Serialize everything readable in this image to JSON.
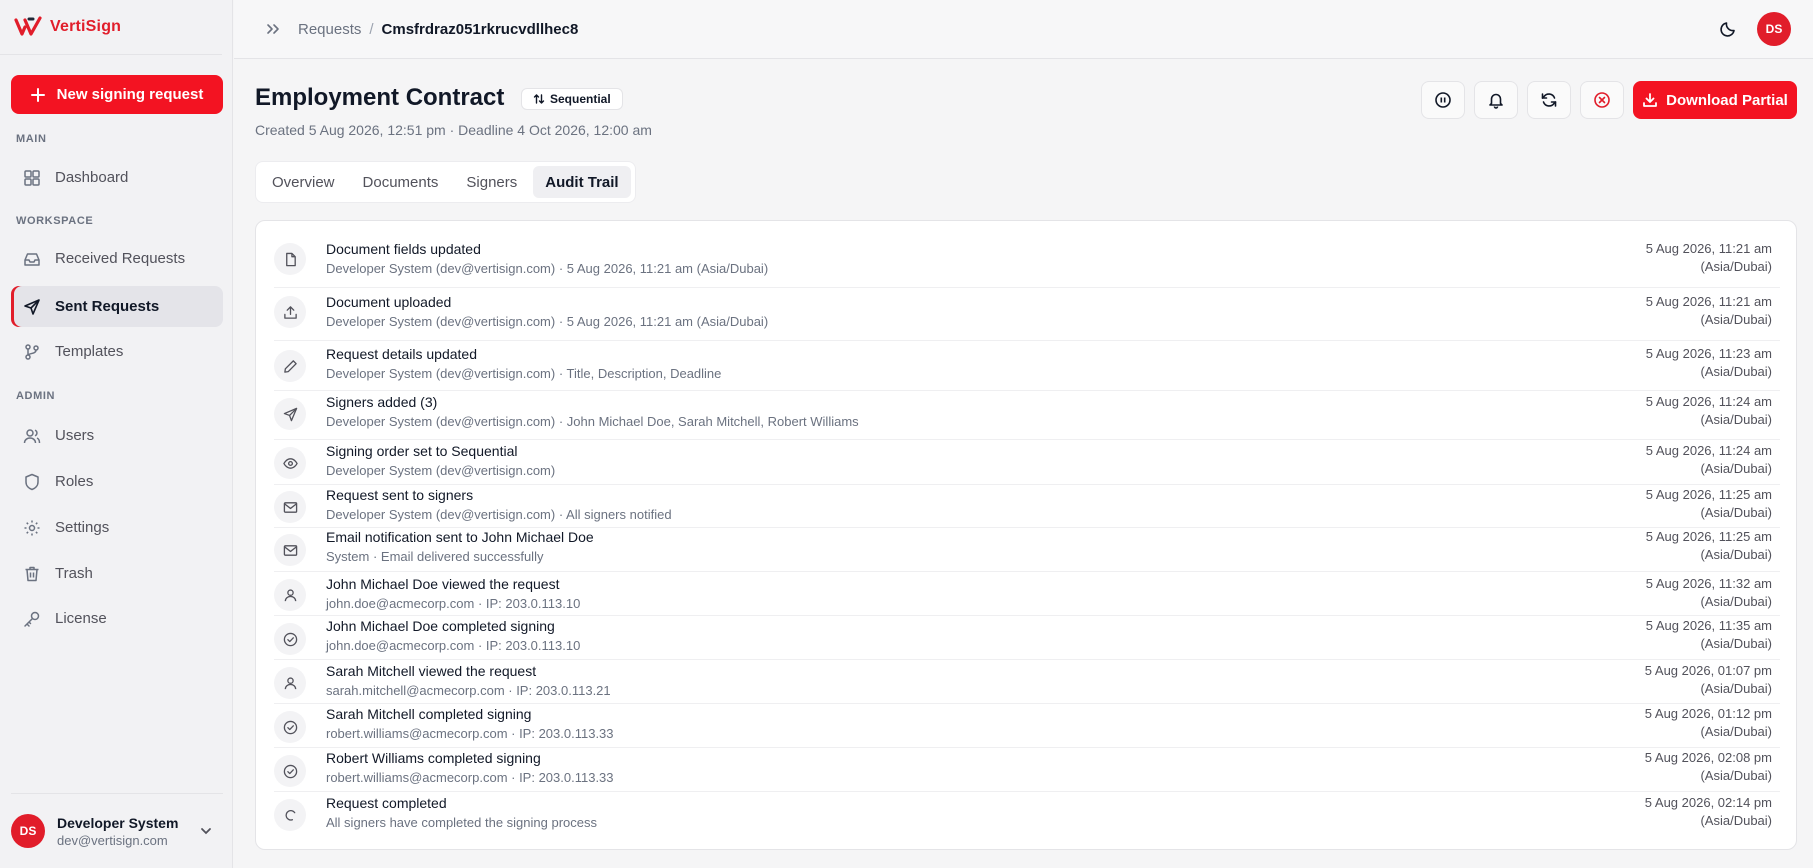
{
  "brand": {
    "name": "VertiSign",
    "accent": "#e11d2a"
  },
  "sidebar": {
    "new_button": "New signing request",
    "sections": {
      "main": "MAIN",
      "workspace": "WORKSPACE",
      "admin": "ADMIN"
    },
    "items": [
      {
        "label": "Dashboard",
        "icon": "dashboard-icon"
      },
      {
        "label": "Received Requests",
        "icon": "inbox-icon"
      },
      {
        "label": "Sent Requests",
        "icon": "send-icon",
        "active": true
      },
      {
        "label": "Templates",
        "icon": "branch-icon"
      },
      {
        "label": "Users",
        "icon": "users-icon"
      },
      {
        "label": "Roles",
        "icon": "shield-icon"
      },
      {
        "label": "Settings",
        "icon": "gear-icon"
      },
      {
        "label": "Trash",
        "icon": "trash-icon"
      },
      {
        "label": "License",
        "icon": "key-icon"
      }
    ],
    "user": {
      "initials": "DS",
      "name": "Developer System",
      "email": "dev@vertisign.com"
    }
  },
  "topbar": {
    "breadcrumb": {
      "parent": "Requests",
      "separator": "/",
      "current": "Cmsfrdraz051rkrucvdllhec8"
    },
    "avatar_initials": "DS"
  },
  "header": {
    "title": "Employment Contract",
    "badge": "Sequential",
    "meta": "Created 5 Aug 2026, 12:51 pm · Deadline 4 Oct 2026, 12:00 am",
    "download_label": "Download Partial"
  },
  "tabs": [
    {
      "label": "Overview"
    },
    {
      "label": "Documents"
    },
    {
      "label": "Signers"
    },
    {
      "label": "Audit Trail",
      "active": true
    }
  ],
  "audit": [
    {
      "icon": "file-icon",
      "title": "Document fields updated",
      "sub": "Developer System (dev@vertisign.com) · 5 Aug 2026, 11:21 am (Asia/Dubai)",
      "time": "5 Aug 2026, 11:21 am",
      "tz": "(Asia/Dubai)"
    },
    {
      "icon": "upload-icon",
      "title": "Document uploaded",
      "sub": "Developer System (dev@vertisign.com) · 5 Aug 2026, 11:21 am (Asia/Dubai)",
      "time": "5 Aug 2026, 11:21 am",
      "tz": "(Asia/Dubai)"
    },
    {
      "icon": "pencil-icon",
      "title": "Request details updated",
      "sub": "Developer System (dev@vertisign.com) · Title, Description, Deadline",
      "time": "5 Aug 2026, 11:23 am",
      "tz": "(Asia/Dubai)"
    },
    {
      "icon": "send-icon",
      "title": "Signers added (3)",
      "sub": "Developer System (dev@vertisign.com) · John Michael Doe, Sarah Mitchell, Robert Williams",
      "time": "5 Aug 2026, 11:24 am",
      "tz": "(Asia/Dubai)"
    },
    {
      "icon": "eye-icon",
      "title": "Signing order set to Sequential",
      "sub": "Developer System (dev@vertisign.com)",
      "time": "5 Aug 2026, 11:24 am",
      "tz": "(Asia/Dubai)"
    },
    {
      "icon": "mail-icon",
      "title": "Request sent to signers",
      "sub": "Developer System (dev@vertisign.com) · All signers notified",
      "time": "5 Aug 2026, 11:25 am",
      "tz": "(Asia/Dubai)"
    },
    {
      "icon": "mail-icon",
      "title": "Email notification sent to John Michael Doe",
      "sub": "System · Email delivered successfully",
      "time": "5 Aug 2026, 11:25 am",
      "tz": "(Asia/Dubai)"
    },
    {
      "icon": "user-icon",
      "title": "John Michael Doe viewed the request",
      "sub": "john.doe@acmecorp.com · IP: 203.0.113.10",
      "time": "5 Aug 2026, 11:32 am",
      "tz": "(Asia/Dubai)"
    },
    {
      "icon": "check-circle-icon",
      "title": "John Michael Doe completed signing",
      "sub": "john.doe@acmecorp.com · IP: 203.0.113.10",
      "time": "5 Aug 2026, 11:35 am",
      "tz": "(Asia/Dubai)"
    },
    {
      "icon": "user-icon",
      "title": "Sarah Mitchell viewed the request",
      "sub": "sarah.mitchell@acmecorp.com · IP: 203.0.113.21",
      "time": "5 Aug 2026, 01:07 pm",
      "tz": "(Asia/Dubai)"
    },
    {
      "icon": "check-circle-icon",
      "title": "Sarah Mitchell completed signing",
      "sub": "robert.williams@acmecorp.com · IP: 203.0.113.33",
      "time": "5 Aug 2026, 01:12 pm",
      "tz": "(Asia/Dubai)"
    },
    {
      "icon": "check-circle-icon",
      "title": "Robert Williams completed signing",
      "sub": "robert.williams@acmecorp.com · IP: 203.0.113.33",
      "time": "5 Aug 2026, 02:08 pm",
      "tz": "(Asia/Dubai)"
    },
    {
      "icon": "circle-icon",
      "title": "Request completed",
      "sub": "All signers have completed the signing process",
      "time": "5 Aug 2026, 02:14 pm",
      "tz": "(Asia/Dubai)"
    }
  ]
}
